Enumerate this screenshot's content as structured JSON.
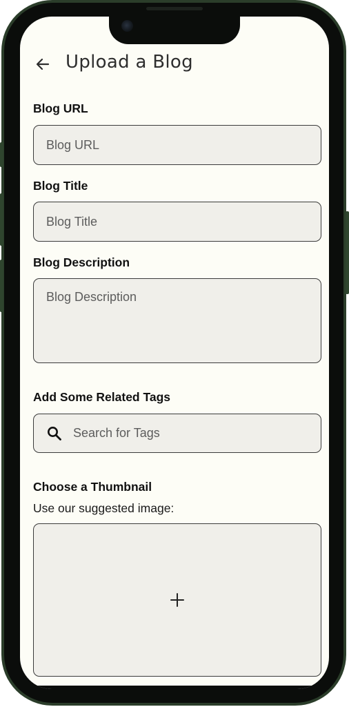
{
  "header": {
    "title": "Upload a Blog",
    "back_icon": "arrow-left-icon"
  },
  "form": {
    "url": {
      "label": "Blog URL",
      "placeholder": "Blog URL",
      "value": ""
    },
    "title": {
      "label": "Blog Title",
      "placeholder": "Blog Title",
      "value": ""
    },
    "description": {
      "label": "Blog Description",
      "placeholder": "Blog Description",
      "value": ""
    },
    "tags": {
      "label": "Add Some Related Tags",
      "placeholder": "Search for Tags",
      "value": "",
      "icon": "search-icon"
    },
    "thumbnail": {
      "label": "Choose a Thumbnail",
      "hint": "Use our suggested image:",
      "icon": "plus-icon"
    }
  },
  "colors": {
    "screen_background": "#fdfdf6",
    "field_background": "#f0efea",
    "field_border": "#3a3a3a",
    "phone_frame": "#2b3d2a"
  }
}
